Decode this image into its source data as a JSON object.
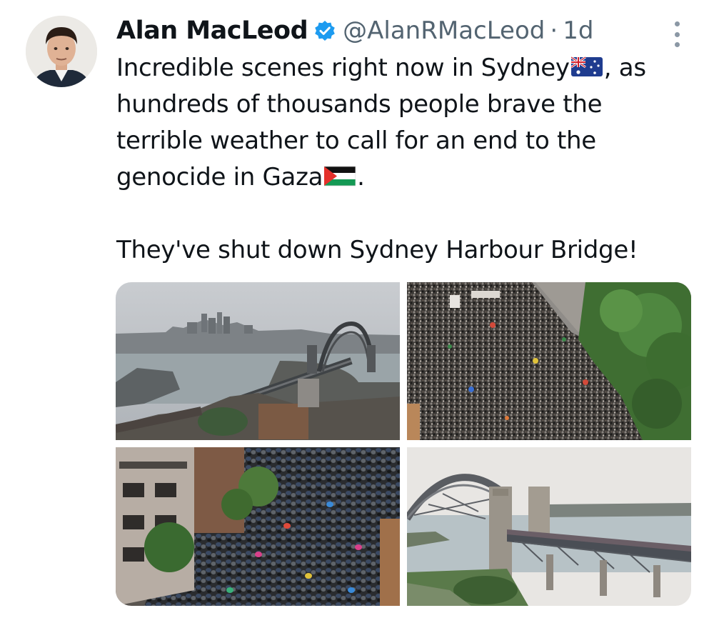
{
  "tweet": {
    "author_name": "Alan MacLeod",
    "handle": "@AlanRMacLeod",
    "separator": "·",
    "timestamp": "1d",
    "verified": true,
    "text_line_1": "Incredible scenes right now in Sydney",
    "text_after_au_flag": ", as hundreds of thousands people brave the terrible weather to call for an end to the genocide in Gaza",
    "text_after_ps_flag": ".",
    "text_paragraph_2": "They've shut down Sydney Harbour Bridge!",
    "emoji_flags": [
      "australia-flag",
      "palestine-flag"
    ]
  },
  "media": {
    "photos": [
      {
        "subject": "harbour-bridge-city-view"
      },
      {
        "subject": "crowd-aerial-street"
      },
      {
        "subject": "umbrella-crowd-street"
      },
      {
        "subject": "harbour-bridge-pylons-crowd"
      }
    ]
  },
  "colors": {
    "verified_blue": "#1d9bf0",
    "secondary_text": "#536471",
    "text": "#0f1419"
  }
}
